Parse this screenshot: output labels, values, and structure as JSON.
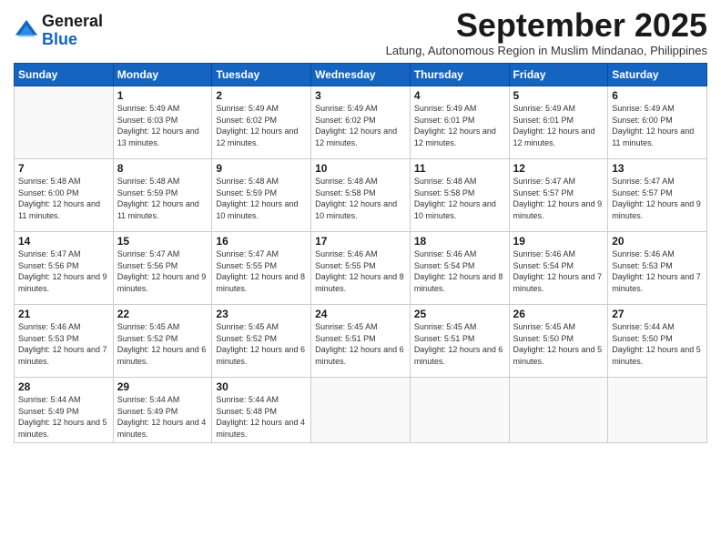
{
  "header": {
    "logo_line1": "General",
    "logo_line2": "Blue",
    "month_title": "September 2025",
    "subtitle": "Latung, Autonomous Region in Muslim Mindanao, Philippines"
  },
  "weekdays": [
    "Sunday",
    "Monday",
    "Tuesday",
    "Wednesday",
    "Thursday",
    "Friday",
    "Saturday"
  ],
  "weeks": [
    [
      {
        "day": "",
        "sunrise": "",
        "sunset": "",
        "daylight": ""
      },
      {
        "day": "1",
        "sunrise": "Sunrise: 5:49 AM",
        "sunset": "Sunset: 6:03 PM",
        "daylight": "Daylight: 12 hours and 13 minutes."
      },
      {
        "day": "2",
        "sunrise": "Sunrise: 5:49 AM",
        "sunset": "Sunset: 6:02 PM",
        "daylight": "Daylight: 12 hours and 12 minutes."
      },
      {
        "day": "3",
        "sunrise": "Sunrise: 5:49 AM",
        "sunset": "Sunset: 6:02 PM",
        "daylight": "Daylight: 12 hours and 12 minutes."
      },
      {
        "day": "4",
        "sunrise": "Sunrise: 5:49 AM",
        "sunset": "Sunset: 6:01 PM",
        "daylight": "Daylight: 12 hours and 12 minutes."
      },
      {
        "day": "5",
        "sunrise": "Sunrise: 5:49 AM",
        "sunset": "Sunset: 6:01 PM",
        "daylight": "Daylight: 12 hours and 12 minutes."
      },
      {
        "day": "6",
        "sunrise": "Sunrise: 5:49 AM",
        "sunset": "Sunset: 6:00 PM",
        "daylight": "Daylight: 12 hours and 11 minutes."
      }
    ],
    [
      {
        "day": "7",
        "sunrise": "Sunrise: 5:48 AM",
        "sunset": "Sunset: 6:00 PM",
        "daylight": "Daylight: 12 hours and 11 minutes."
      },
      {
        "day": "8",
        "sunrise": "Sunrise: 5:48 AM",
        "sunset": "Sunset: 5:59 PM",
        "daylight": "Daylight: 12 hours and 11 minutes."
      },
      {
        "day": "9",
        "sunrise": "Sunrise: 5:48 AM",
        "sunset": "Sunset: 5:59 PM",
        "daylight": "Daylight: 12 hours and 10 minutes."
      },
      {
        "day": "10",
        "sunrise": "Sunrise: 5:48 AM",
        "sunset": "Sunset: 5:58 PM",
        "daylight": "Daylight: 12 hours and 10 minutes."
      },
      {
        "day": "11",
        "sunrise": "Sunrise: 5:48 AM",
        "sunset": "Sunset: 5:58 PM",
        "daylight": "Daylight: 12 hours and 10 minutes."
      },
      {
        "day": "12",
        "sunrise": "Sunrise: 5:47 AM",
        "sunset": "Sunset: 5:57 PM",
        "daylight": "Daylight: 12 hours and 9 minutes."
      },
      {
        "day": "13",
        "sunrise": "Sunrise: 5:47 AM",
        "sunset": "Sunset: 5:57 PM",
        "daylight": "Daylight: 12 hours and 9 minutes."
      }
    ],
    [
      {
        "day": "14",
        "sunrise": "Sunrise: 5:47 AM",
        "sunset": "Sunset: 5:56 PM",
        "daylight": "Daylight: 12 hours and 9 minutes."
      },
      {
        "day": "15",
        "sunrise": "Sunrise: 5:47 AM",
        "sunset": "Sunset: 5:56 PM",
        "daylight": "Daylight: 12 hours and 9 minutes."
      },
      {
        "day": "16",
        "sunrise": "Sunrise: 5:47 AM",
        "sunset": "Sunset: 5:55 PM",
        "daylight": "Daylight: 12 hours and 8 minutes."
      },
      {
        "day": "17",
        "sunrise": "Sunrise: 5:46 AM",
        "sunset": "Sunset: 5:55 PM",
        "daylight": "Daylight: 12 hours and 8 minutes."
      },
      {
        "day": "18",
        "sunrise": "Sunrise: 5:46 AM",
        "sunset": "Sunset: 5:54 PM",
        "daylight": "Daylight: 12 hours and 8 minutes."
      },
      {
        "day": "19",
        "sunrise": "Sunrise: 5:46 AM",
        "sunset": "Sunset: 5:54 PM",
        "daylight": "Daylight: 12 hours and 7 minutes."
      },
      {
        "day": "20",
        "sunrise": "Sunrise: 5:46 AM",
        "sunset": "Sunset: 5:53 PM",
        "daylight": "Daylight: 12 hours and 7 minutes."
      }
    ],
    [
      {
        "day": "21",
        "sunrise": "Sunrise: 5:46 AM",
        "sunset": "Sunset: 5:53 PM",
        "daylight": "Daylight: 12 hours and 7 minutes."
      },
      {
        "day": "22",
        "sunrise": "Sunrise: 5:45 AM",
        "sunset": "Sunset: 5:52 PM",
        "daylight": "Daylight: 12 hours and 6 minutes."
      },
      {
        "day": "23",
        "sunrise": "Sunrise: 5:45 AM",
        "sunset": "Sunset: 5:52 PM",
        "daylight": "Daylight: 12 hours and 6 minutes."
      },
      {
        "day": "24",
        "sunrise": "Sunrise: 5:45 AM",
        "sunset": "Sunset: 5:51 PM",
        "daylight": "Daylight: 12 hours and 6 minutes."
      },
      {
        "day": "25",
        "sunrise": "Sunrise: 5:45 AM",
        "sunset": "Sunset: 5:51 PM",
        "daylight": "Daylight: 12 hours and 6 minutes."
      },
      {
        "day": "26",
        "sunrise": "Sunrise: 5:45 AM",
        "sunset": "Sunset: 5:50 PM",
        "daylight": "Daylight: 12 hours and 5 minutes."
      },
      {
        "day": "27",
        "sunrise": "Sunrise: 5:44 AM",
        "sunset": "Sunset: 5:50 PM",
        "daylight": "Daylight: 12 hours and 5 minutes."
      }
    ],
    [
      {
        "day": "28",
        "sunrise": "Sunrise: 5:44 AM",
        "sunset": "Sunset: 5:49 PM",
        "daylight": "Daylight: 12 hours and 5 minutes."
      },
      {
        "day": "29",
        "sunrise": "Sunrise: 5:44 AM",
        "sunset": "Sunset: 5:49 PM",
        "daylight": "Daylight: 12 hours and 4 minutes."
      },
      {
        "day": "30",
        "sunrise": "Sunrise: 5:44 AM",
        "sunset": "Sunset: 5:48 PM",
        "daylight": "Daylight: 12 hours and 4 minutes."
      },
      {
        "day": "",
        "sunrise": "",
        "sunset": "",
        "daylight": ""
      },
      {
        "day": "",
        "sunrise": "",
        "sunset": "",
        "daylight": ""
      },
      {
        "day": "",
        "sunrise": "",
        "sunset": "",
        "daylight": ""
      },
      {
        "day": "",
        "sunrise": "",
        "sunset": "",
        "daylight": ""
      }
    ]
  ]
}
